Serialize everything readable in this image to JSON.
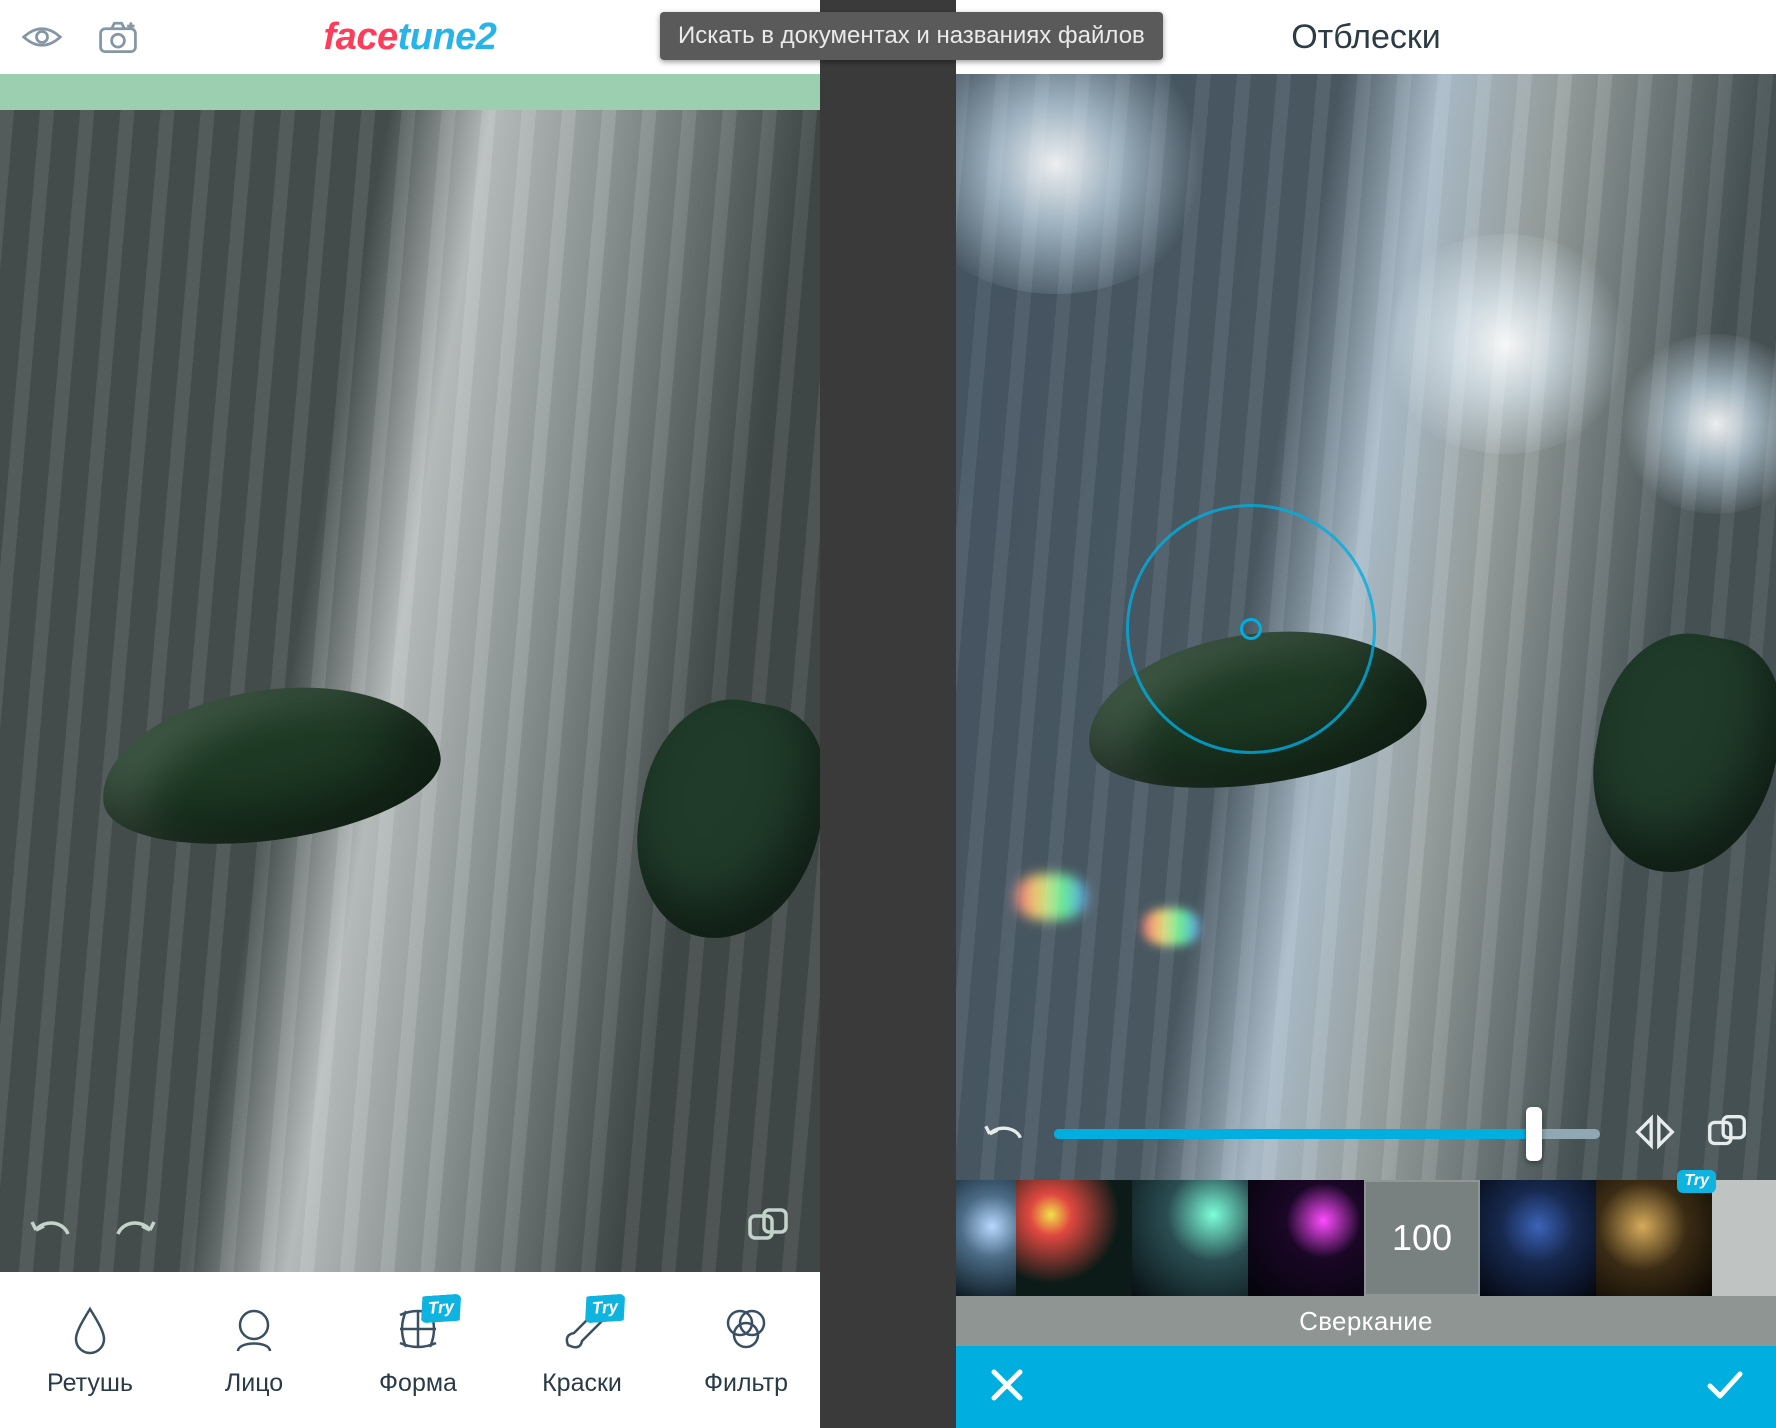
{
  "os_tooltip": "Искать в документах и названиях файлов",
  "left_phone": {
    "brand_part1": "face",
    "brand_part2": "tune2",
    "header_icons": [
      "eye-icon",
      "camera-plus-icon",
      "import-image-icon",
      "frames-icon"
    ],
    "footer_icons": [
      "undo-icon",
      "redo-icon",
      "compare-icon"
    ],
    "tools": [
      {
        "label": "Ретушь",
        "icon": "droplet-icon",
        "try": false
      },
      {
        "label": "Лицо",
        "icon": "face-icon",
        "try": false
      },
      {
        "label": "Форма",
        "icon": "grid-warp-icon",
        "try": true
      },
      {
        "label": "Краски",
        "icon": "brush-icon",
        "try": true
      },
      {
        "label": "Фильтр",
        "icon": "rings-icon",
        "try": false
      }
    ]
  },
  "right_phone": {
    "title": "Отблески",
    "header_icon": "export-icon",
    "slider_percent": 88,
    "controls": [
      "undo-icon",
      "mirror-icon",
      "compare-icon"
    ],
    "selected_effect_value": "100",
    "selected_effect_label": "Сверкание",
    "effects_count": 7,
    "effects_try_index": 6,
    "bottom_actions": [
      "cancel-icon",
      "confirm-icon"
    ],
    "brush_ring_hint": "effect-placement-ring"
  },
  "colors": {
    "accent": "#00aee0",
    "brand_red": "#ff3d5a",
    "brand_blue": "#28b4e8",
    "canvas_mint": "#9ccfaf"
  }
}
